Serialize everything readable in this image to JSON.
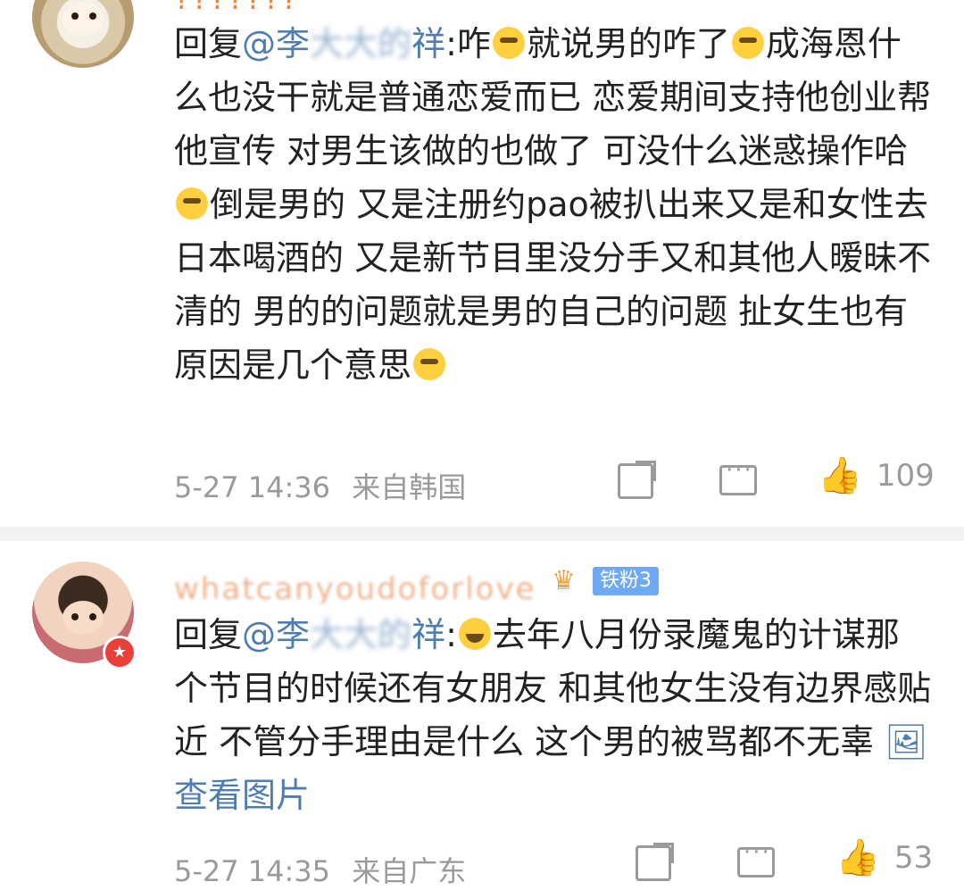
{
  "comments": [
    {
      "username": "???????",
      "reply_prefix": "回复",
      "mention": "@李",
      "mention_blurred": "大大的",
      "mention_tail": "祥",
      "text_part1": ":咋",
      "text_part2": "就说男的咋了",
      "text_part3": "成海恩什么也没干就是普通恋爱而已 恋爱期间支持他创业帮他宣传 对男生该做的也做了 可没什么迷惑操作哈",
      "text_part4": "倒是男的 又是注册约pao被扒出来又是和女性去日本喝酒的 又是新节目里没分手又和其他人暧昧不清的 男的的问题就是男的自己的问题 扯女生也有原因是几个意思",
      "timestamp": "5-27 14:36",
      "source": "来自韩国",
      "like_count": "109"
    },
    {
      "username": "whatcanyoudoforlove",
      "fan_label": "铁粉3",
      "reply_prefix": "回复",
      "mention": "@李",
      "mention_blurred": "大大的",
      "mention_tail": "祥",
      "text_part1": ":",
      "text_part2": "去年八月份录魔鬼的计谋那个节目的时候还有女朋友 和其他女生没有边界感贴近 不管分手理由是什么 这个男的被骂都不无辜",
      "image_link": "查看图片",
      "timestamp": "5-27 14:35",
      "source": "来自广东",
      "like_count": "53"
    }
  ],
  "colors": {
    "link": "#507daf",
    "meta": "#9a9a9a",
    "badge": "#6fa8f5"
  },
  "icons": [
    "share-icon",
    "comment-icon",
    "like-icon",
    "image-icon"
  ]
}
